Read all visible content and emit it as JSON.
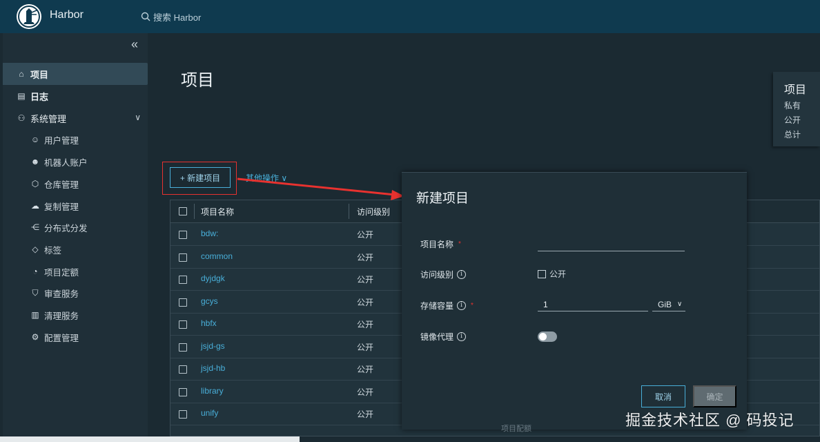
{
  "header": {
    "app_name": "Harbor",
    "search_placeholder": "搜索 Harbor"
  },
  "sidebar": {
    "collapse_glyph": "«",
    "items": [
      {
        "label": "项目",
        "icon": "project-icon",
        "glyph": "⌂",
        "active": true
      },
      {
        "label": "日志",
        "icon": "log-icon",
        "glyph": "▤"
      },
      {
        "label": "系统管理",
        "icon": "admin-icon",
        "glyph": "⚇",
        "expanded": true
      }
    ],
    "sub_items": [
      {
        "label": "用户管理",
        "icon": "users-icon",
        "glyph": "☺"
      },
      {
        "label": "机器人账户",
        "icon": "robot-icon",
        "glyph": "☻"
      },
      {
        "label": "仓库管理",
        "icon": "registry-icon",
        "glyph": "⬡"
      },
      {
        "label": "复制管理",
        "icon": "replication-icon",
        "glyph": "☁"
      },
      {
        "label": "分布式分发",
        "icon": "distribution-icon",
        "glyph": "⋲"
      },
      {
        "label": "标签",
        "icon": "tag-icon",
        "glyph": "◇"
      },
      {
        "label": "项目定额",
        "icon": "quota-icon",
        "glyph": "◔"
      },
      {
        "label": "审查服务",
        "icon": "shield-icon",
        "glyph": "⛉"
      },
      {
        "label": "清理服务",
        "icon": "trash-icon",
        "glyph": "▥"
      },
      {
        "label": "配置管理",
        "icon": "gear-icon",
        "glyph": "⚙"
      }
    ]
  },
  "main": {
    "title": "项目",
    "summary": {
      "title": "项目",
      "rows": [
        "私有",
        "公开",
        "总计"
      ]
    },
    "new_project_label": "+ 新建项目",
    "other_ops_label": "其他操作 ∨",
    "table": {
      "columns": [
        "项目名称",
        "访问级别"
      ],
      "rows": [
        {
          "name": "bdw:",
          "access": "公开"
        },
        {
          "name": "common",
          "access": "公开"
        },
        {
          "name": "dyjdgk",
          "access": "公开"
        },
        {
          "name": "gcys",
          "access": "公开"
        },
        {
          "name": "hbfx",
          "access": "公开"
        },
        {
          "name": "jsjd-gs",
          "access": "公开"
        },
        {
          "name": "jsjd-hb",
          "access": "公开"
        },
        {
          "name": "library",
          "access": "公开"
        },
        {
          "name": "unify",
          "access": "公开"
        }
      ]
    }
  },
  "modal": {
    "title": "新建项目",
    "project_name_label": "项目名称",
    "project_name_value": "",
    "access_label": "访问级别",
    "public_label": "公开",
    "public_checked": false,
    "storage_label": "存储容量",
    "storage_value": "1",
    "storage_unit": "GiB",
    "proxy_label": "镜像代理",
    "proxy_enabled": false,
    "cancel_label": "取消",
    "ok_label": "确定",
    "footer_text": "项目配额"
  },
  "watermark": "掘金技术社区 @ 码投记",
  "colors": {
    "accent": "#49afd9",
    "header": "#0f3a4f",
    "annotation": "#e8322f"
  }
}
